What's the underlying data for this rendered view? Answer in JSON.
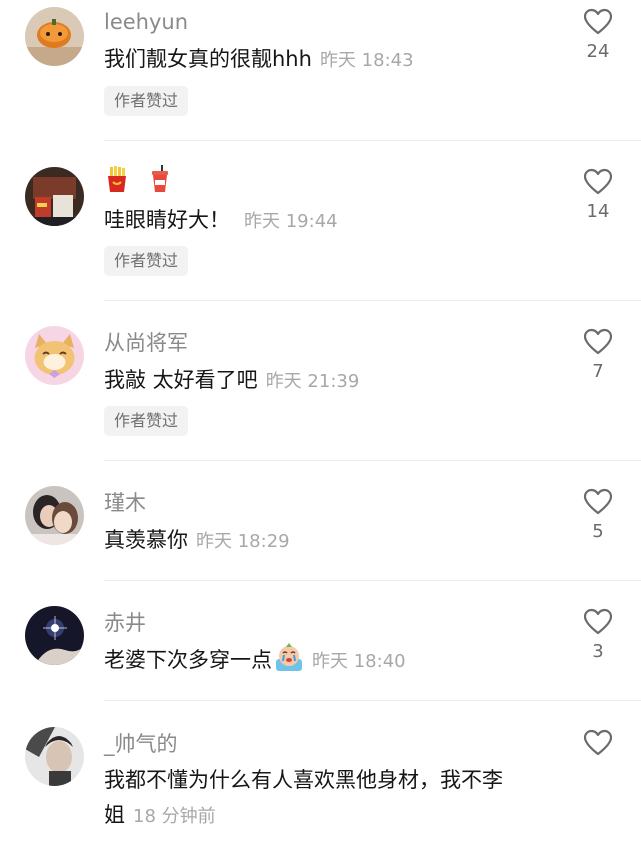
{
  "comments": [
    {
      "username": "leehyun",
      "text": "我们靓女真的很靓hhh",
      "time": "昨天 18:43",
      "likes": "24",
      "badge": "作者赞过"
    },
    {
      "username": "",
      "text": "哇眼睛好大！",
      "time": "昨天 19:44",
      "likes": "14",
      "badge": "作者赞过",
      "username_icons": [
        "fries-icon",
        "drink-cup-icon"
      ]
    },
    {
      "username": "从尚将军",
      "text": "我敲 太好看了吧",
      "time": "昨天 21:39",
      "likes": "7",
      "badge": "作者赞过"
    },
    {
      "username": "瑾木",
      "text": "真羡慕你",
      "time": "昨天 18:29",
      "likes": "5"
    },
    {
      "username": "赤井",
      "text": "老婆下次多穿一点",
      "time": "昨天 18:40",
      "likes": "3",
      "inline_emoji": "crying-sticker-icon"
    },
    {
      "username": "_帅气的",
      "text_line1": "我都不懂为什么有人喜欢黑他身材，我不李",
      "text_line2": "姐",
      "time": "18 分钟前",
      "likes": ""
    }
  ]
}
